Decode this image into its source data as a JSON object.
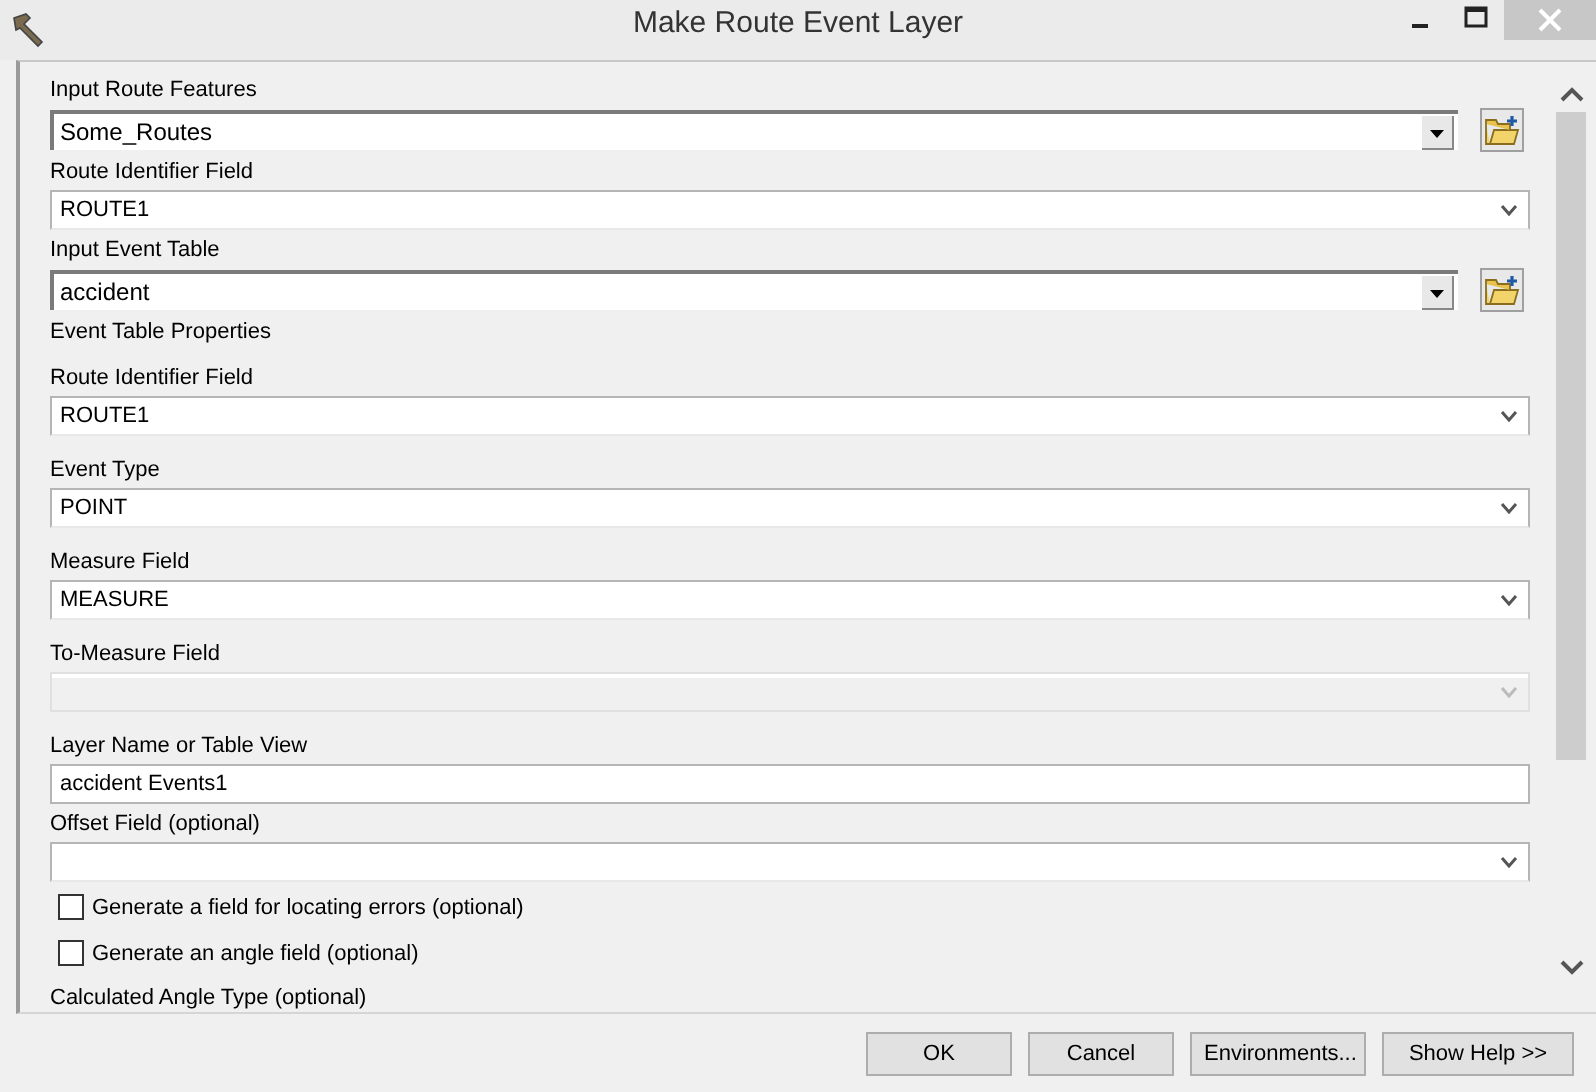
{
  "window": {
    "title": "Make Route Event Layer"
  },
  "parameters": [
    {
      "kind": "combo-browse",
      "label": "Input Route Features",
      "value": "Some_Routes",
      "disabled": false
    },
    {
      "kind": "dropdown",
      "label": "Route Identifier Field",
      "value": "ROUTE1",
      "disabled": false
    },
    {
      "kind": "combo-browse",
      "label": "Input Event Table",
      "value": "accident",
      "disabled": false
    },
    {
      "kind": "heading",
      "label": "Event Table Properties"
    },
    {
      "kind": "dropdown",
      "label": "Route Identifier Field",
      "value": "ROUTE1",
      "disabled": false
    },
    {
      "kind": "dropdown",
      "label": "Event Type",
      "value": "POINT",
      "disabled": false
    },
    {
      "kind": "dropdown",
      "label": "Measure Field",
      "value": "MEASURE",
      "disabled": false
    },
    {
      "kind": "dropdown",
      "label": "To-Measure Field",
      "disabled": true
    },
    {
      "kind": "text",
      "label": "Layer Name or Table View",
      "value": "accident Events1",
      "disabled": false
    },
    {
      "kind": "dropdown",
      "label": "Offset Field (optional)",
      "disabled": false
    },
    {
      "kind": "checkbox",
      "label": "Generate a field for locating errors (optional)",
      "checked": false
    },
    {
      "kind": "checkbox",
      "label": "Generate an angle field (optional)",
      "checked": false
    },
    {
      "kind": "heading",
      "label": "Calculated Angle Type (optional)"
    }
  ],
  "buttons": [
    "OK",
    "Cancel",
    "Environments...",
    "Show Help >>"
  ]
}
